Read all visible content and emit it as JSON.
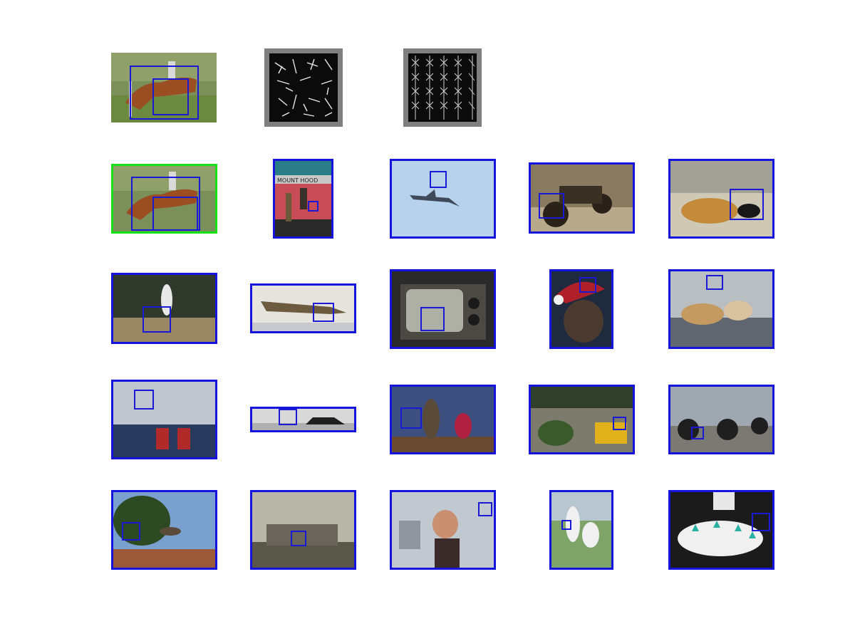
{
  "colors": {
    "query_frame": "#16e016",
    "result_frame": "#1414dc",
    "detection_box": "#1a1ad6",
    "hog_border": "#7f7f7f"
  },
  "query": {
    "image_icon": "horse-jumping-photo",
    "hog_positive_icon": "hog-feature-visualization",
    "hog_negative_icon": "hog-feature-visualization"
  },
  "results": [
    {
      "icon": "horse-jumping-photo"
    },
    {
      "icon": "mount-hood-train-photo"
    },
    {
      "icon": "airplane-sky-photo"
    },
    {
      "icon": "motorcycle-sepia-photo"
    },
    {
      "icon": "dog-on-sofa-photo"
    },
    {
      "icon": "stork-on-rock-photo"
    },
    {
      "icon": "bomber-airplane-photo"
    },
    {
      "icon": "retro-television-photo"
    },
    {
      "icon": "santa-hat-cat-photo"
    },
    {
      "icon": "dogs-on-leash-photo"
    },
    {
      "icon": "airplane-cabin-photo"
    },
    {
      "icon": "black-car-photo"
    },
    {
      "icon": "classroom-people-photo"
    },
    {
      "icon": "school-bus-field-photo"
    },
    {
      "icon": "vintage-motorcycles-photo"
    },
    {
      "icon": "stork-nest-tree-photo"
    },
    {
      "icon": "lounge-room-photo"
    },
    {
      "icon": "woman-lab-photo"
    },
    {
      "icon": "cricket-players-photo"
    },
    {
      "icon": "dining-table-photo"
    }
  ]
}
